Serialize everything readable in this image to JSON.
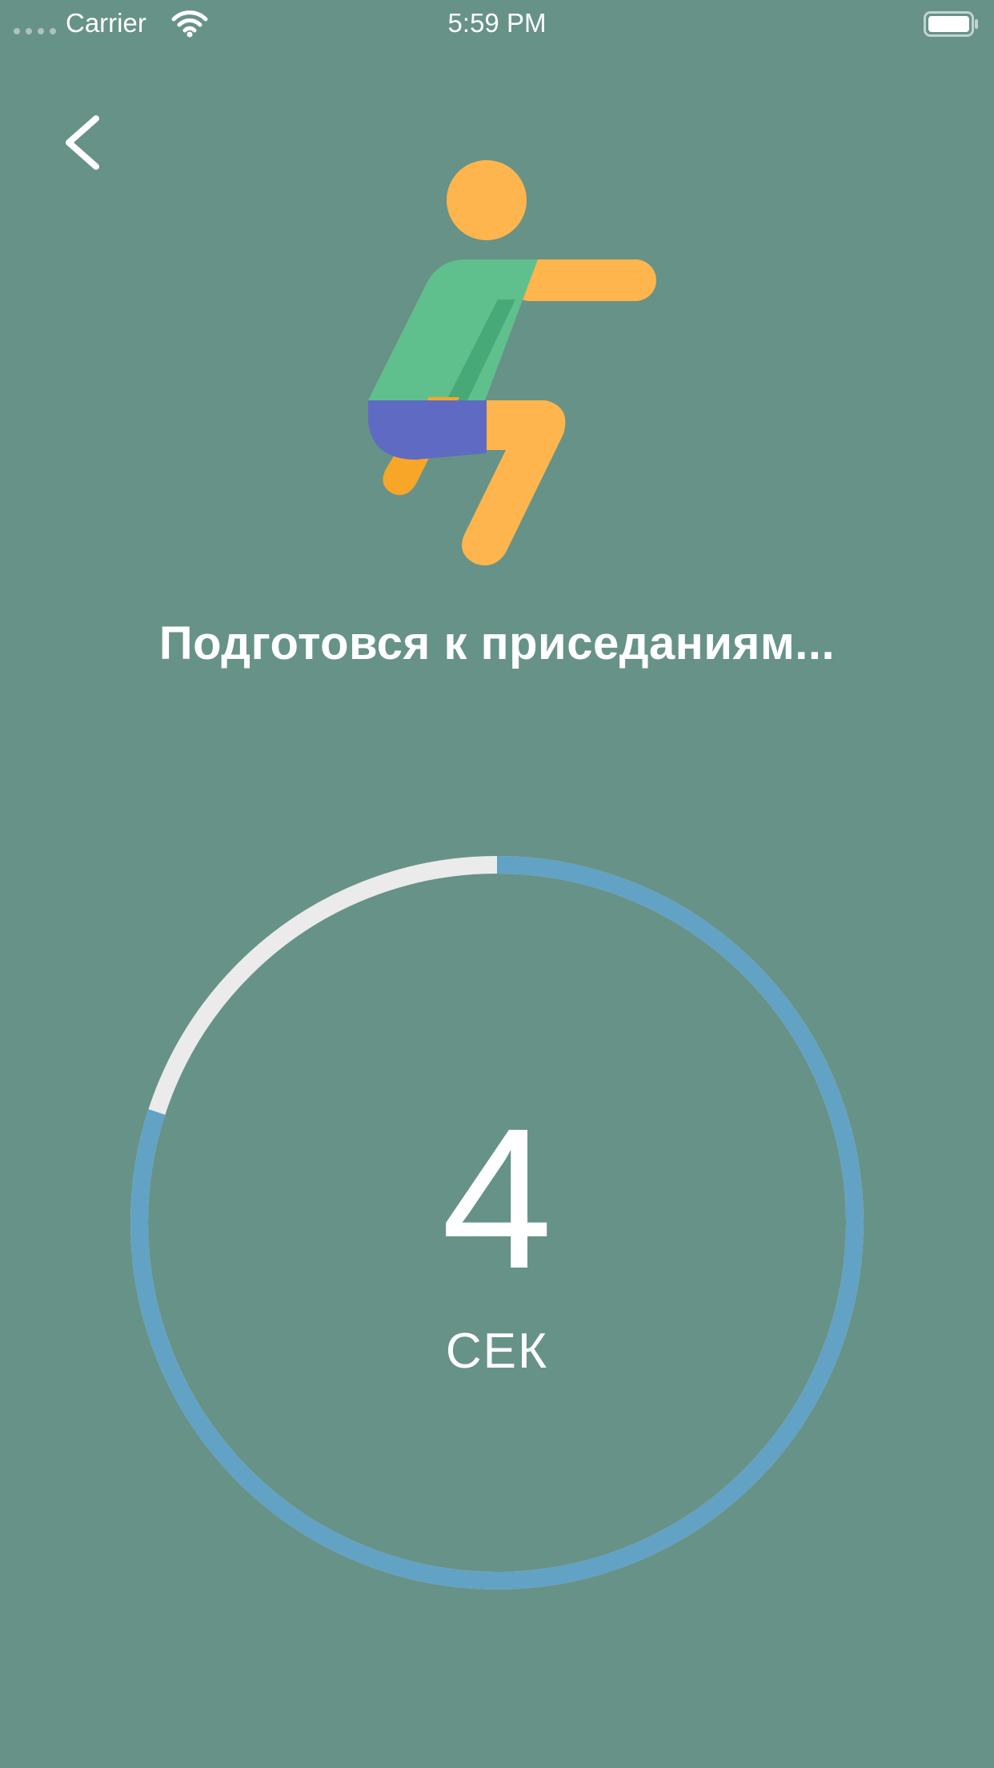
{
  "status_bar": {
    "carrier": "Carrier",
    "time": "5:59 PM"
  },
  "nav": {
    "back_icon": "chevron-left-icon"
  },
  "exercise": {
    "illustration_icon": "squat-figure-icon",
    "prompt": "Подготовся к приседаниям..."
  },
  "countdown": {
    "value": "4",
    "unit": "СЕК",
    "progress_remaining": 0.8
  },
  "colors": {
    "background": "#679287",
    "ring_progress": "#62a2c4",
    "ring_track": "#ebebeb"
  }
}
